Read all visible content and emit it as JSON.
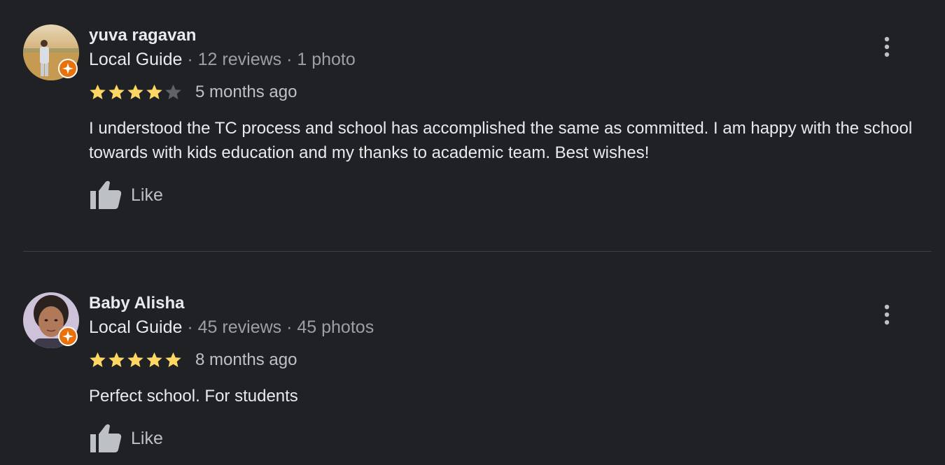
{
  "reviews": [
    {
      "name": "yuva ragavan",
      "badge": "Local Guide",
      "reviews_count": "12 reviews",
      "photos_count": "1 photo",
      "rating": 4,
      "date": "5 months ago",
      "text": "I understood the TC process and school has accomplished the same as committed. I am happy with the school towards with kids education and my thanks to academic team. Best wishes!",
      "like_label": "Like",
      "avatar_icon": "avatar-photo-outdoor"
    },
    {
      "name": "Baby Alisha",
      "badge": "Local Guide",
      "reviews_count": "45 reviews",
      "photos_count": "45 photos",
      "rating": 5,
      "date": "8 months ago",
      "text": "Perfect school. For students",
      "like_label": "Like",
      "avatar_icon": "avatar-photo-portrait"
    }
  ],
  "colors": {
    "background": "#202124",
    "star_filled": "#fdd663",
    "star_empty": "#5f6368",
    "badge": "#e8710a",
    "divider": "#3c4043"
  }
}
